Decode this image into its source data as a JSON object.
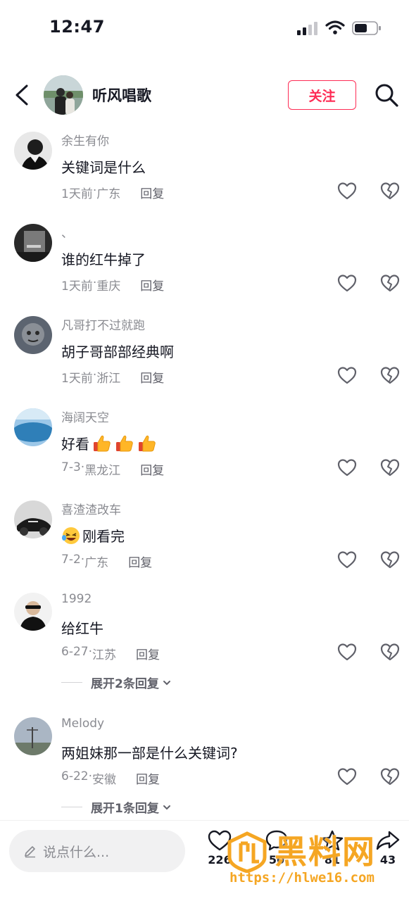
{
  "status_bar": {
    "time": "12:47"
  },
  "header": {
    "title": "听风唱歌",
    "follow_label": "关注"
  },
  "comments": [
    {
      "user": "余生有你",
      "text": "关键词是什么",
      "time": "1天前",
      "location": "广东",
      "reply_label": "回复"
    },
    {
      "user": "、",
      "text": "谁的红牛掉了",
      "time": "1天前",
      "location": "重庆",
      "reply_label": "回复"
    },
    {
      "user": "凡哥打不过就跑",
      "text": "胡子哥部部经典啊",
      "time": "1天前",
      "location": "浙江",
      "reply_label": "回复"
    },
    {
      "user": "海阔天空",
      "text": "好看",
      "time": "7-3",
      "location": "黑龙江",
      "reply_label": "回复"
    },
    {
      "user": "喜渣渣改车",
      "text": "刚看完",
      "time": "7-2",
      "location": "广东",
      "reply_label": "回复"
    },
    {
      "user": "1992",
      "text": "给红牛",
      "time": "6-27",
      "location": "江苏",
      "reply_label": "回复",
      "expand_label": "展开2条回复"
    },
    {
      "user": "Melody",
      "text": "两姐妹那一部是什么关键词?",
      "time": "6-22",
      "location": "安徽",
      "reply_label": "回复",
      "expand_label": "展开1条回复"
    }
  ],
  "meta_separator": "·",
  "bottom_bar": {
    "input_placeholder": "说点什么...",
    "like_count": "226",
    "comment_count": "50",
    "favorite_count": "81",
    "share_count": "43"
  },
  "watermark": {
    "title": "黑料网",
    "url": "https://hlwe16.com"
  },
  "colors": {
    "accent": "#fe2c55",
    "text": "#161823",
    "muted": "#8a8b91",
    "watermark": "#f5a623"
  },
  "icons": [
    "back-arrow-icon",
    "search-icon",
    "heart-icon",
    "broken-heart-icon",
    "pencil-icon",
    "comment-icon",
    "star-icon",
    "share-icon",
    "chevron-down-icon"
  ]
}
